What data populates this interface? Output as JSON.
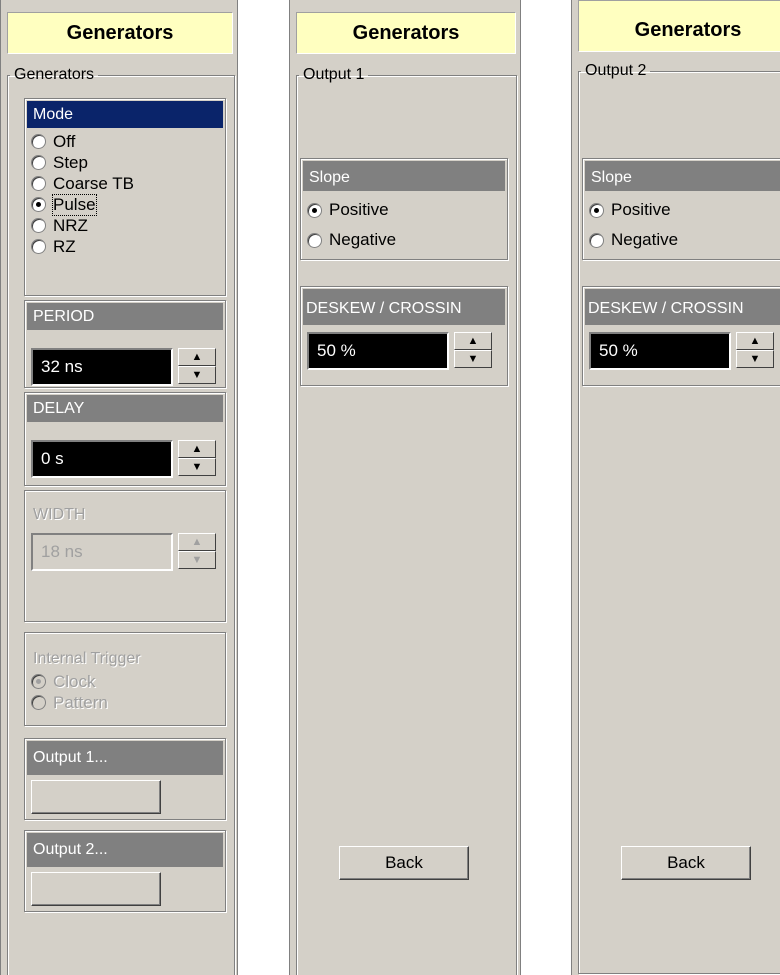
{
  "panels": [
    {
      "title": "Generators",
      "group_label": "Generators",
      "mode": {
        "header": "Mode",
        "options": [
          "Off",
          "Step",
          "Coarse TB",
          "Pulse",
          "NRZ",
          "RZ"
        ],
        "selected": "Pulse"
      },
      "period": {
        "header": "PERIOD",
        "value": "32 ns"
      },
      "delay": {
        "header": "DELAY",
        "value": "0 s"
      },
      "width": {
        "header": "WIDTH",
        "value": "18 ns"
      },
      "internal_trigger": {
        "header": "Internal Trigger",
        "options": [
          "Clock",
          "Pattern"
        ],
        "selected": "Clock"
      },
      "output1": {
        "header": "Output 1...",
        "button_label": ""
      },
      "output2": {
        "header": "Output 2...",
        "button_label": ""
      }
    },
    {
      "title": "Generators",
      "group_label": "Output 1",
      "slope": {
        "header": "Slope",
        "options": [
          "Positive",
          "Negative"
        ],
        "selected": "Positive"
      },
      "deskew": {
        "header": "DESKEW / CROSSIN",
        "value": "50 %"
      },
      "back_label": "Back"
    },
    {
      "title": "Generators",
      "group_label": "Output 2",
      "slope": {
        "header": "Slope",
        "options": [
          "Positive",
          "Negative"
        ],
        "selected": "Positive"
      },
      "deskew": {
        "header": "DESKEW / CROSSIN",
        "value": "50 %"
      },
      "back_label": "Back"
    }
  ],
  "icons": {
    "spin_up": "up-arrow-icon",
    "spin_down": "down-arrow-icon"
  },
  "colors": {
    "panel_bg": "#d4d0c8",
    "title_bg": "#ffffc0",
    "header_gray": "#808080",
    "header_selected": "#0a246a",
    "value_bg": "#000000"
  }
}
